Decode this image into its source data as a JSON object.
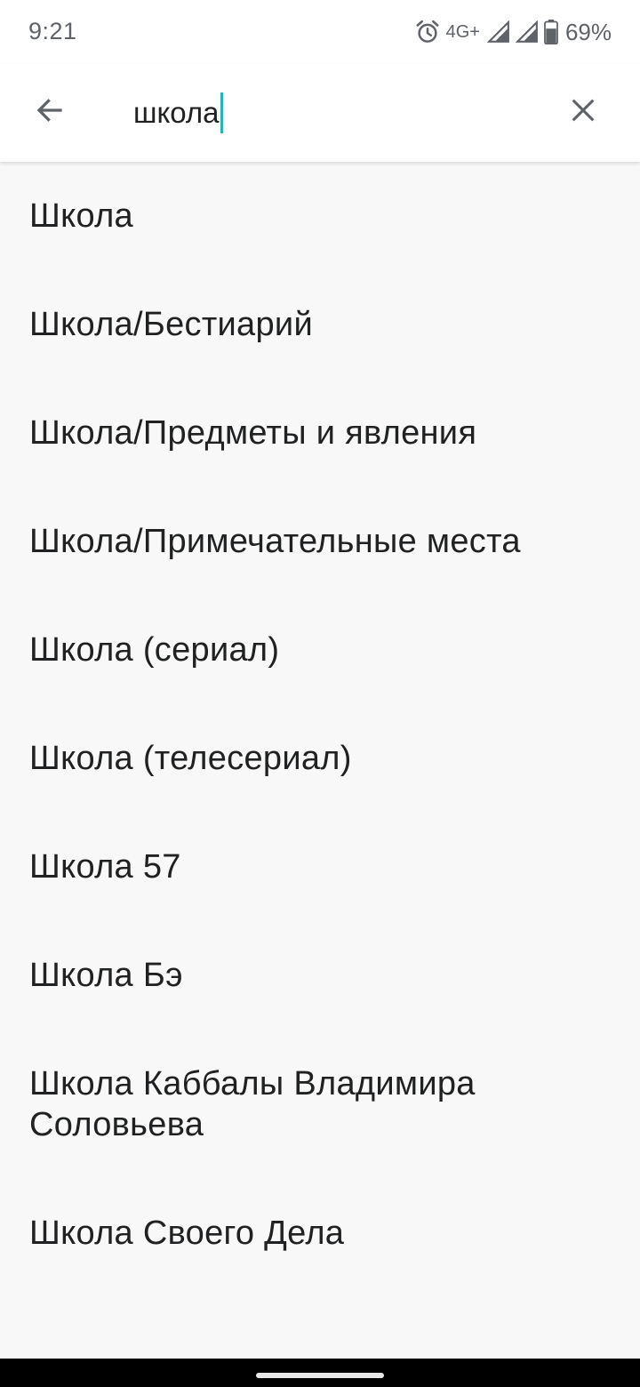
{
  "status_bar": {
    "time": "9:21",
    "network": "4G+",
    "battery": "69%",
    "icons": [
      "alarm-icon",
      "signal-icon",
      "signal-icon",
      "battery-icon"
    ]
  },
  "search": {
    "query": "школа",
    "back_icon": "arrow-left-icon",
    "clear_icon": "close-icon",
    "caret_color": "#26b5b5"
  },
  "results": [
    "Школа",
    "Школа/Бестиарий",
    "Школа/Предметы и явления",
    "Школа/Примечательные места",
    "Школа (сериал)",
    "Школа (телесериал)",
    "Школа 57",
    "Школа Бэ",
    "Школа Каббалы Владимира Соловьева",
    "Школа Своего Дела"
  ]
}
